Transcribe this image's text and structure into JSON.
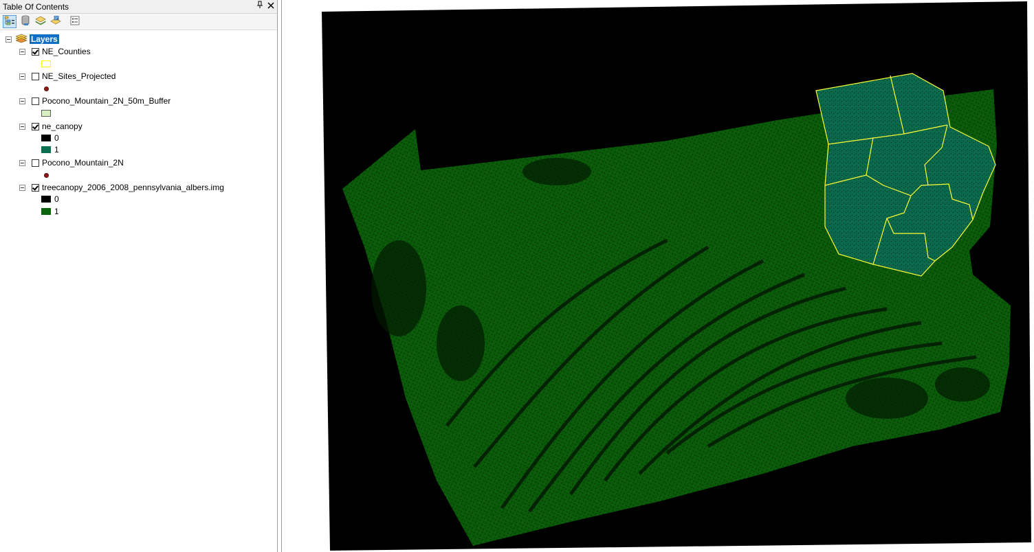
{
  "toc": {
    "title": "Table Of Contents",
    "pin_icon": "pin-icon",
    "close_icon": "close-icon",
    "toolbar": [
      {
        "name": "list-by-drawing-order",
        "icon": "list-by-drawing-order-icon",
        "active": true
      },
      {
        "name": "list-by-source",
        "icon": "database-icon",
        "active": false
      },
      {
        "name": "list-by-visibility",
        "icon": "layers-icon",
        "active": false
      },
      {
        "name": "list-by-selection",
        "icon": "selection-icon",
        "active": false
      },
      {
        "name": "options",
        "icon": "options-icon",
        "active": false
      }
    ],
    "root_label": "Layers",
    "layers": [
      {
        "name": "NE_Counties",
        "checked": true,
        "legend": [
          {
            "type": "polygon",
            "fill": "#ffffff",
            "outline": "#ffff00",
            "label": ""
          }
        ]
      },
      {
        "name": "NE_Sites_Projected",
        "checked": false,
        "legend": [
          {
            "type": "point",
            "fill": "#8b1a1a",
            "label": ""
          }
        ]
      },
      {
        "name": "Pocono_Mountain_2N_50m_Buffer",
        "checked": false,
        "legend": [
          {
            "type": "polygon",
            "fill": "#d8f0c0",
            "outline": "#5a5a5a",
            "label": ""
          }
        ]
      },
      {
        "name": "ne_canopy",
        "checked": true,
        "legend": [
          {
            "type": "raster",
            "fill": "#000000",
            "label": "0"
          },
          {
            "type": "raster",
            "fill": "#08704f",
            "label": "1"
          }
        ]
      },
      {
        "name": "Pocono_Mountain_2N",
        "checked": false,
        "legend": [
          {
            "type": "point",
            "fill": "#8b1a1a",
            "label": ""
          }
        ]
      },
      {
        "name": "treecanopy_2006_2008_pennsylvania_albers.img",
        "checked": true,
        "legend": [
          {
            "type": "raster",
            "fill": "#000000",
            "label": "0"
          },
          {
            "type": "raster",
            "fill": "#0a640a",
            "label": "1"
          }
        ]
      }
    ]
  },
  "map": {
    "background_color": "#ffffff",
    "raster_nodata_color": "#000000",
    "canopy_color": "#0a5a0a",
    "ne_canopy_color": "#0b6a4c",
    "county_outline_color": "#ffff33"
  }
}
